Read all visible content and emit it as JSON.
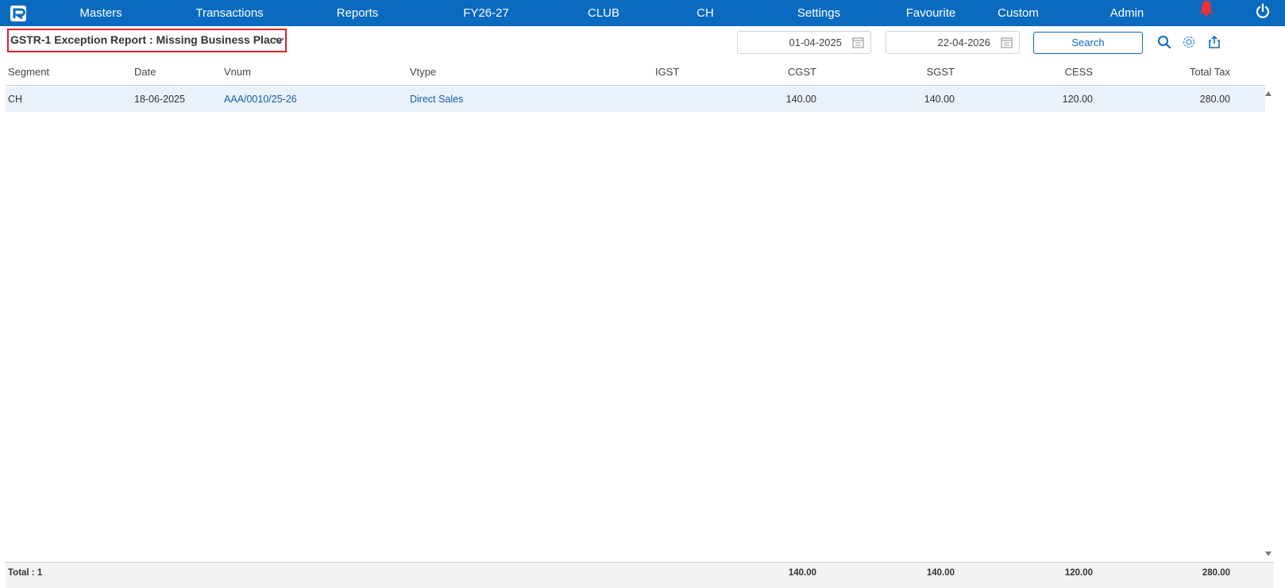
{
  "nav": {
    "items": [
      "Masters",
      "Transactions",
      "Reports",
      "FY26-27",
      "CLUB",
      "CH",
      "Settings",
      "Favourite",
      "Custom",
      "Admin"
    ]
  },
  "report": {
    "title": "GSTR-1 Exception Report : Missing Business Place"
  },
  "filters": {
    "from_date": "01-04-2025",
    "to_date": "22-04-2026",
    "search_label": "Search"
  },
  "table": {
    "columns": [
      "Segment",
      "Date",
      "Vnum",
      "Vtype",
      "IGST",
      "CGST",
      "SGST",
      "CESS",
      "Total Tax"
    ],
    "rows": [
      {
        "segment": "CH",
        "date": "18-06-2025",
        "vnum": "AAA/0010/25-26",
        "vtype": "Direct Sales",
        "igst": "",
        "cgst": "140.00",
        "sgst": "140.00",
        "cess": "120.00",
        "total_tax": "280.00"
      }
    ]
  },
  "footer": {
    "total_label": "Total : 1",
    "cgst": "140.00",
    "sgst": "140.00",
    "cess": "120.00",
    "total_tax": "280.00"
  },
  "icons": {
    "logo": "app-logo",
    "bell": "bell-icon",
    "power": "power-icon",
    "calendar": "calendar-icon",
    "search": "search-icon",
    "settings": "gear-icon",
    "export": "export-icon"
  },
  "colors": {
    "navbar": "#0a6ac0",
    "title_border": "#d8232a",
    "row_highlight": "#e9f1fb",
    "link": "#1a5ea8",
    "bell": "#e8323a"
  }
}
